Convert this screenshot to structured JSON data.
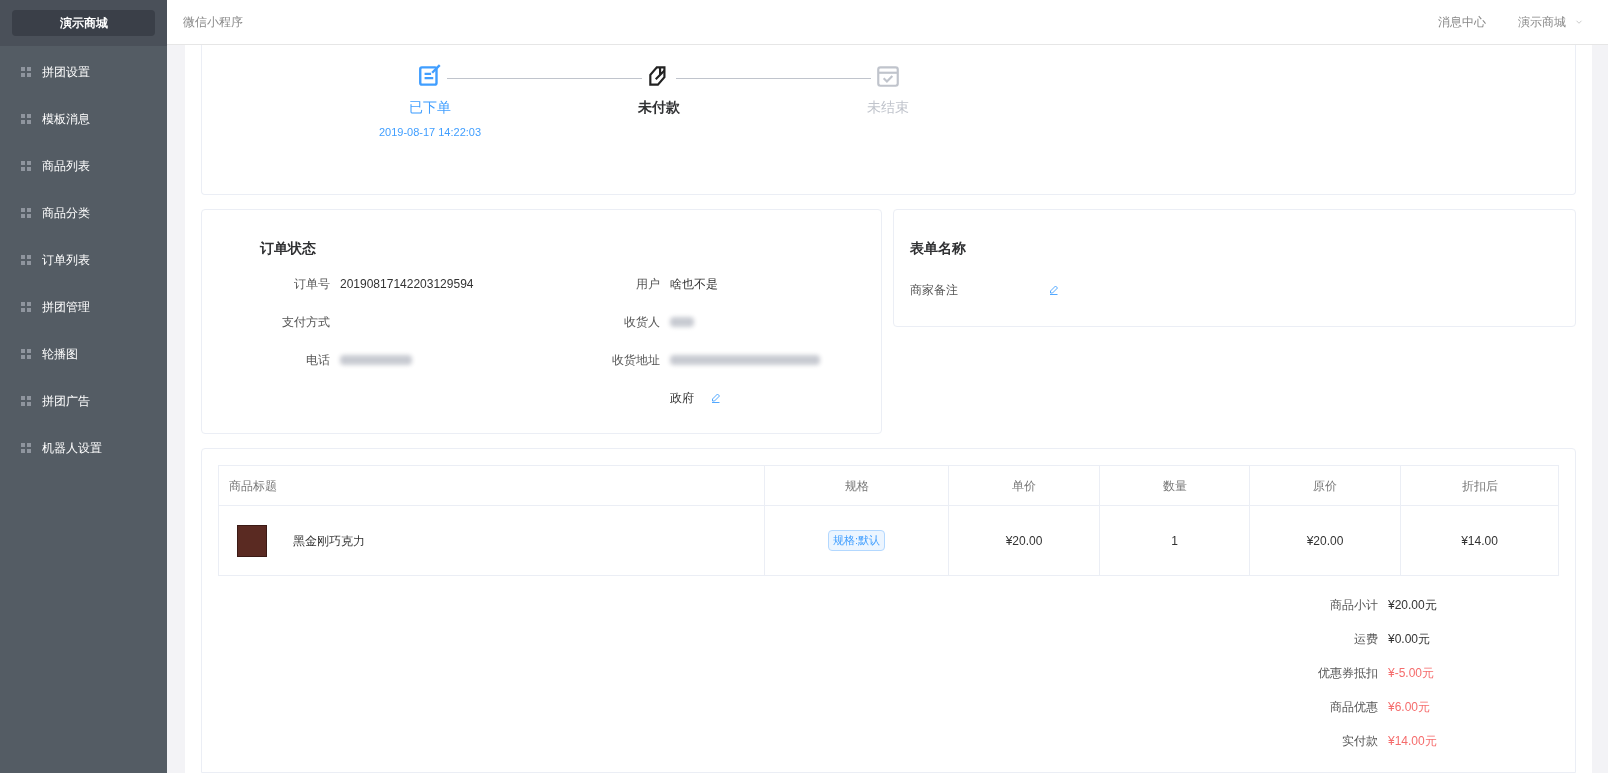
{
  "sidebar": {
    "brand": "演示商城",
    "items": [
      {
        "label": "拼团设置"
      },
      {
        "label": "模板消息"
      },
      {
        "label": "商品列表"
      },
      {
        "label": "商品分类"
      },
      {
        "label": "订单列表"
      },
      {
        "label": "拼团管理"
      },
      {
        "label": "轮播图"
      },
      {
        "label": "拼团广告"
      },
      {
        "label": "机器人设置"
      }
    ]
  },
  "header": {
    "title": "微信小程序",
    "links": [
      "消息中心"
    ],
    "account": "演示商城"
  },
  "steps": [
    {
      "label": "已下单",
      "time": "2019-08-17 14:22:03",
      "kind": "done"
    },
    {
      "label": "未付款",
      "kind": "current"
    },
    {
      "label": "未结束",
      "kind": "pending"
    }
  ],
  "order": {
    "title": "订单状态",
    "left": [
      {
        "label": "订单号",
        "value": "20190817142203129594"
      },
      {
        "label": "支付方式"
      },
      {
        "label": "电话",
        "redacted": true
      }
    ],
    "right": [
      {
        "label": "用户",
        "value": "啥也不是"
      },
      {
        "label": "收货人",
        "redacted": true
      },
      {
        "label": "收货地址",
        "redacted": true
      }
    ],
    "address_tail": "政府"
  },
  "form": {
    "title": "表单名称",
    "remark_label": "商家备注"
  },
  "table": {
    "columns": [
      "商品标题",
      "规格",
      "单价",
      "数量",
      "原价",
      "折扣后"
    ],
    "rows": [
      {
        "title": "黑金刚巧克力",
        "spec": "规格:默认",
        "price": "¥20.00",
        "qty": "1",
        "original": "¥20.00",
        "discounted": "¥14.00"
      }
    ]
  },
  "summary": [
    {
      "label": "商品小计",
      "value": "¥20.00元",
      "highlight": false
    },
    {
      "label": "运费",
      "value": "¥0.00元",
      "highlight": false
    },
    {
      "label": "优惠券抵扣",
      "value": "¥-5.00元",
      "highlight": true
    },
    {
      "label": "商品优惠",
      "value": "¥6.00元",
      "highlight": true
    },
    {
      "label": "实付款",
      "value": "¥14.00元",
      "highlight": true
    }
  ]
}
